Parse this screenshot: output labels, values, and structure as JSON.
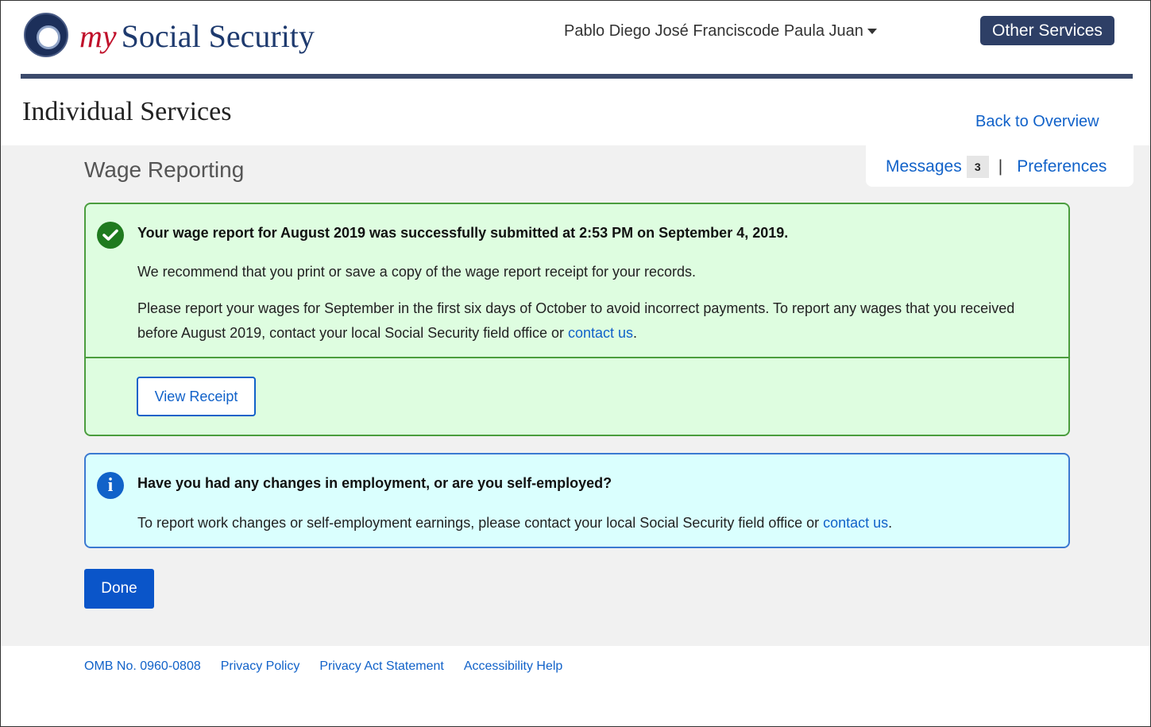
{
  "header": {
    "brand_my": "my",
    "brand_rest": "Social Security",
    "user_name": "Pablo Diego José Franciscode Paula Juan",
    "other_services": "Other Services"
  },
  "title_area": {
    "page_title": "Individual Services",
    "back_link": "Back to Overview"
  },
  "tabs": {
    "messages_label": "Messages",
    "messages_count": "3",
    "separator": "|",
    "preferences_label": "Preferences"
  },
  "section_title": "Wage Reporting",
  "success_alert": {
    "title": "Your wage report for August 2019 was successfully submitted at 2:53 PM on September 4, 2019.",
    "paragraph1": "We recommend that you print or save a copy of the wage report receipt for your records.",
    "paragraph2_text": "Please report your wages for September in the first six days of October to avoid incorrect payments. To report any wages that you received before August 2019, contact your local Social Security field office or ",
    "paragraph2_link": "contact us",
    "paragraph2_end": ".",
    "view_receipt": "View Receipt"
  },
  "info_alert": {
    "title": "Have you had any changes in employment, or are you self-employed?",
    "text": "To report work changes or self-employment earnings, please contact your local Social Security field office or ",
    "link": "contact us",
    "end": "."
  },
  "done_button": "Done",
  "footer": {
    "omb": "OMB No. 0960-0808",
    "privacy_policy": "Privacy Policy",
    "privacy_act": "Privacy Act Statement",
    "accessibility": "Accessibility Help"
  },
  "colors": {
    "brand_red": "#c0112b",
    "brand_navy": "#1e3a6e",
    "link_blue": "#1162c9",
    "success_bg": "#defde0",
    "success_border": "#4b9d3e",
    "info_bg": "#dafffe",
    "info_border": "#3b79d1",
    "primary_button": "#0a55c9"
  },
  "icons": {
    "logo": "ssa-seal-icon",
    "user_caret": "caret-down-icon",
    "success": "check-circle-icon",
    "info": "info-circle-icon"
  }
}
